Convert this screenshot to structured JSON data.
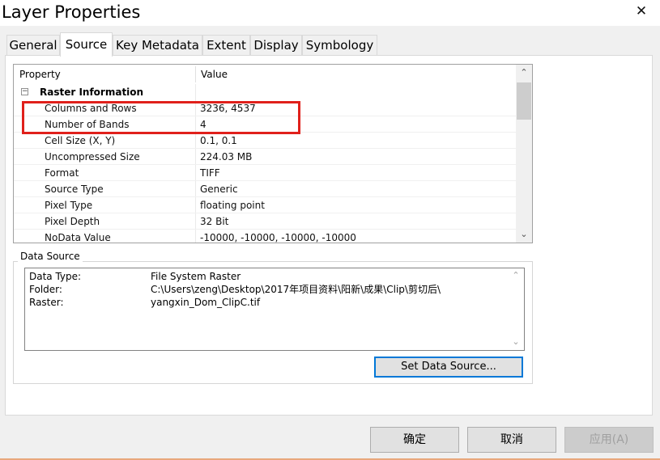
{
  "window": {
    "title": "Layer Properties",
    "close_glyph": "✕"
  },
  "tabs": [
    {
      "label": "General"
    },
    {
      "label": "Source"
    },
    {
      "label": "Key Metadata"
    },
    {
      "label": "Extent"
    },
    {
      "label": "Display"
    },
    {
      "label": "Symbology"
    }
  ],
  "active_tab": "Source",
  "property_grid": {
    "columns": [
      "Property",
      "Value"
    ],
    "group": {
      "expander": "−",
      "label": "Raster Information"
    },
    "rows": [
      {
        "property": "Columns and Rows",
        "value": "3236, 4537"
      },
      {
        "property": "Number of Bands",
        "value": "4"
      },
      {
        "property": "Cell Size (X, Y)",
        "value": "0.1, 0.1"
      },
      {
        "property": "Uncompressed Size",
        "value": "224.03 MB"
      },
      {
        "property": "Format",
        "value": "TIFF"
      },
      {
        "property": "Source Type",
        "value": "Generic"
      },
      {
        "property": "Pixel Type",
        "value": "floating point"
      },
      {
        "property": "Pixel Depth",
        "value": "32 Bit"
      },
      {
        "property": "NoData Value",
        "value": "-10000, -10000, -10000, -10000"
      }
    ],
    "scroll_up": "⌃",
    "scroll_down": "⌄"
  },
  "data_source": {
    "legend": "Data Source",
    "entries": [
      {
        "key": "Data Type:",
        "value": "File System Raster"
      },
      {
        "key": "Folder:",
        "value": "C:\\Users\\zeng\\Desktop\\2017年项目资料\\阳新\\成果\\Clip\\剪切后\\"
      },
      {
        "key": "Raster:",
        "value": "yangxin_Dom_ClipC.tif"
      }
    ],
    "scroll_up": "⌃",
    "scroll_down": "⌄",
    "set_button": "Set Data Source..."
  },
  "footer": {
    "ok": "确定",
    "cancel": "取消",
    "apply": "应用(A)"
  },
  "colors": {
    "highlight": "#e0201b",
    "focus": "#0078d7"
  }
}
